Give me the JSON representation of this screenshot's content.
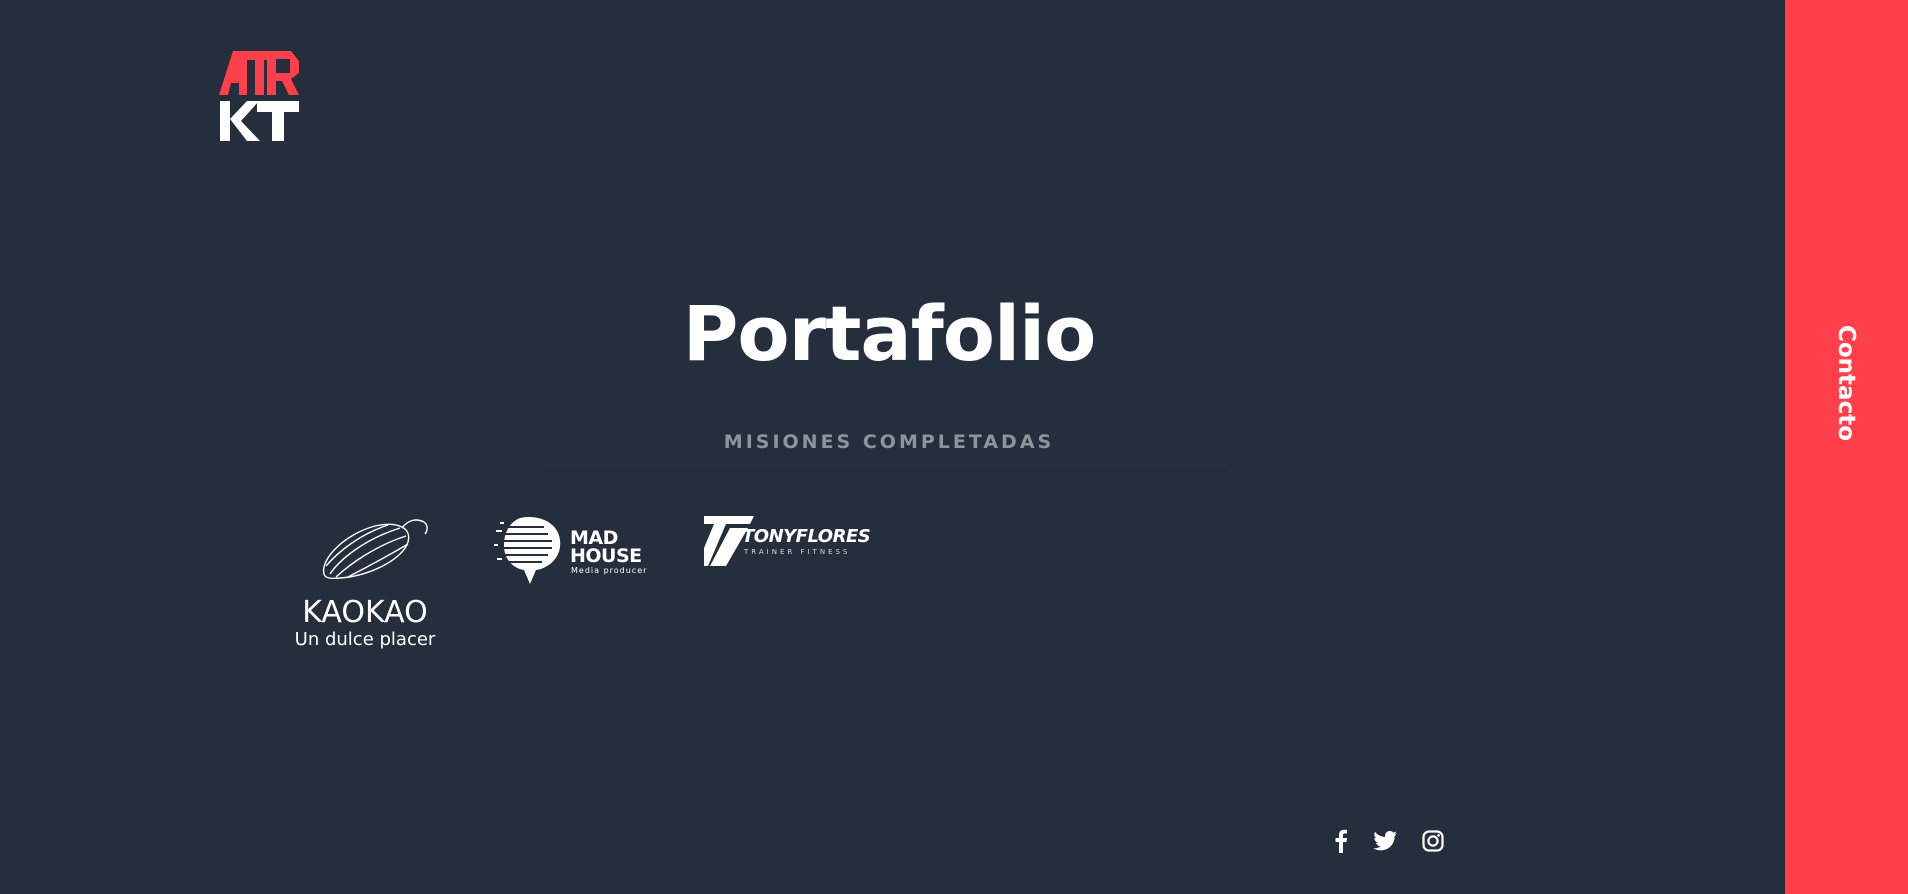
{
  "header": {
    "logo_text_top": "ATR",
    "logo_text_bottom": "KT",
    "logo_icon": "brand-logo-icon"
  },
  "hero": {
    "title": "Portafolio",
    "subtitle": "MISIONES COMPLETADAS"
  },
  "clients": [
    {
      "name": "KAOKAO",
      "tagline": "Un dulce placer",
      "icon": "cacao-pod-icon"
    },
    {
      "name": "MAD HOUSE",
      "tagline": "Media producer",
      "icon": "speech-bubble-icon"
    },
    {
      "name": "TONYFLORES",
      "tagline": "TRAINER FITNESS",
      "icon": "seven-mark-icon"
    }
  ],
  "social": [
    {
      "label": "Facebook",
      "icon": "facebook-icon"
    },
    {
      "label": "Twitter",
      "icon": "twitter-icon"
    },
    {
      "label": "Instagram",
      "icon": "instagram-icon"
    }
  ],
  "sidebar": {
    "contact_label": "Contacto"
  },
  "colors": {
    "background": "#252e3c",
    "accent": "#ff3f4a",
    "subtitle": "#8f949c",
    "text": "#ffffff"
  }
}
